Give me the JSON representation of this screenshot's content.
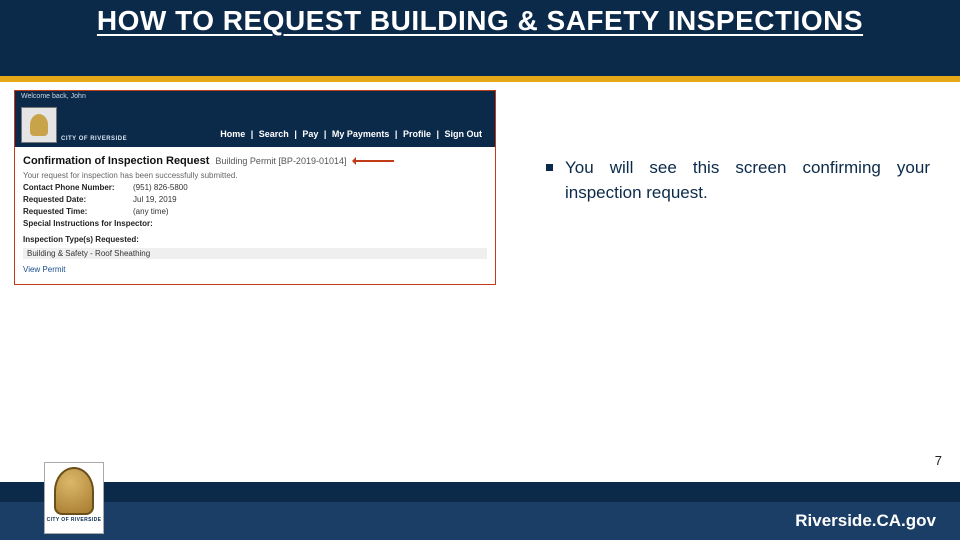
{
  "slide": {
    "title": "HOW TO REQUEST BUILDING & SAFETY INSPECTIONS",
    "page_number": "7",
    "bullet": "You will see this screen confirming your inspection request.",
    "footer_url": "Riverside.CA.gov",
    "footer_brand": "CITY OF\nRIVERSIDE"
  },
  "screenshot": {
    "top_note": "Welcome back, John",
    "brand": "CITY OF\nRIVERSIDE",
    "nav": [
      "Home",
      "Search",
      "Pay",
      "My Payments",
      "Profile",
      "Sign Out"
    ],
    "heading": "Confirmation of Inspection Request",
    "heading_sub": "Building Permit  [BP-2019-01014]",
    "success_note": "Your request for inspection has been successfully submitted.",
    "rows": [
      {
        "label": "Contact Phone Number:",
        "value": "(951) 826-5800"
      },
      {
        "label": "Requested Date:",
        "value": "Jul 19, 2019"
      },
      {
        "label": "Requested Time:",
        "value": "(any time)"
      },
      {
        "label": "Special Instructions for Inspector:",
        "value": ""
      }
    ],
    "type_label": "Inspection Type(s) Requested:",
    "type_value": "Building & Safety - Roof Sheathing",
    "link": "View Permit"
  }
}
